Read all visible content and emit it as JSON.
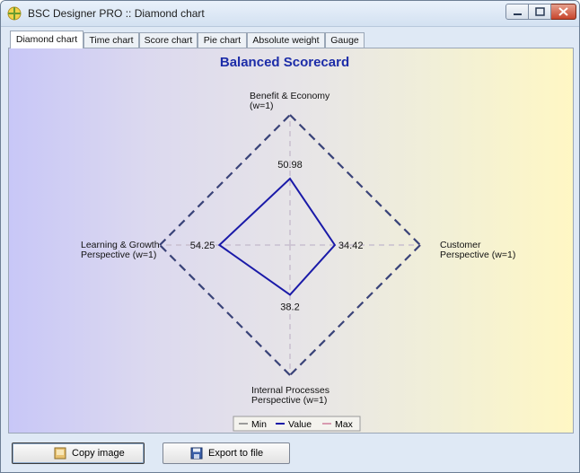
{
  "window": {
    "title": "BSC Designer PRO :: Diamond chart",
    "app_icon": "bsc-designer-icon",
    "buttons": [
      "minimize-icon",
      "maximize-icon",
      "close-icon"
    ]
  },
  "tabs": [
    {
      "label": "Diamond chart",
      "active": true
    },
    {
      "label": "Time chart",
      "active": false
    },
    {
      "label": "Score chart",
      "active": false
    },
    {
      "label": "Pie chart",
      "active": false
    },
    {
      "label": "Absolute weight",
      "active": false
    },
    {
      "label": "Gauge",
      "active": false
    }
  ],
  "chart_data": {
    "type": "radar",
    "title": "Balanced Scorecard",
    "axes": [
      {
        "label_line1": "Benefit & Economy",
        "label_line2": "(w=1)",
        "position": "top"
      },
      {
        "label_line1": "Customer",
        "label_line2": "Perspective (w=1)",
        "position": "right"
      },
      {
        "label_line1": "Internal Processes",
        "label_line2": "Perspective (w=1)",
        "position": "bottom"
      },
      {
        "label_line1": "Learning & Growth",
        "label_line2": "Perspective (w=1)",
        "position": "left"
      }
    ],
    "series": [
      {
        "name": "Min",
        "values": [
          0,
          0,
          0,
          0
        ],
        "color": "#9b9b9b"
      },
      {
        "name": "Value",
        "values": [
          50.98,
          34.42,
          38.2,
          54.25
        ],
        "color": "#1a1aa8"
      },
      {
        "name": "Max",
        "values": [
          100,
          100,
          100,
          100
        ],
        "color": "#d89bb0"
      }
    ],
    "value_labels": [
      "50.98",
      "34.42",
      "38.2",
      "54.25"
    ],
    "range": [
      0,
      100
    ],
    "legend_position": "bottom",
    "dashed_outline_color": "#39457a"
  },
  "footer": {
    "copy_label": "Copy image",
    "export_label": "Export to file",
    "copy_icon": "image-icon",
    "export_icon": "floppy-disk-icon"
  },
  "colors": {
    "title_blue": "#1c2ca8",
    "value_line": "#1a1aa8"
  }
}
